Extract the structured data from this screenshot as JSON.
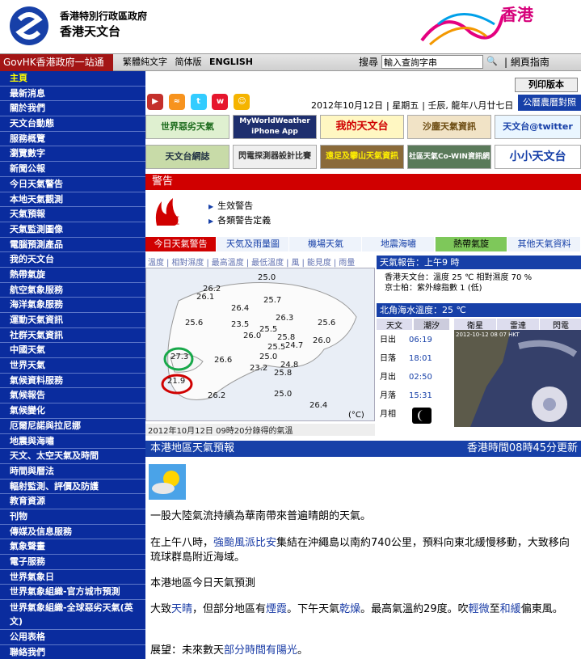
{
  "header": {
    "org_line1": "香港特別行政區政府",
    "org_line2": "香港天文台",
    "brand": "香港"
  },
  "topbar": {
    "govhk": "GovHK香港政府一站通",
    "lang_trad": "繁體純文字",
    "lang_simp": "简体版",
    "lang_en": "ENGLISH",
    "search_label": "搜尋",
    "search_placeholder": "輸入查詢字串",
    "sitemap": "網頁指南"
  },
  "sidebar": {
    "items": [
      "主頁",
      "最新消息",
      "關於我們",
      "天文台動態",
      "服務概覽",
      "瀏覽數字",
      "新聞公報",
      "今日天氣警告",
      "本地天氣觀測",
      "天氣預報",
      "天氣監測圖像",
      "電腦預測產品",
      "我的天文台",
      "熱帶氣旋",
      "航空氣象服務",
      "海洋氣象服務",
      "運動天氣資訊",
      "社群天氣資訊",
      "中國天氣",
      "世界天氣",
      "氣候資料服務",
      "氣候報告",
      "氣候變化",
      "厄爾尼諾與拉尼娜",
      "地震與海嘯",
      "天文、太空天氣及時間",
      "時間與曆法",
      "輻射監測、評價及防護",
      "教育資源",
      "刊物",
      "傳媒及信息服務",
      "氣象聲畫",
      "電子服務",
      "世界氣象日",
      "世界氣象組織-官方城市預測",
      "世界氣象組織-全球惡劣天氣(英文)",
      "公用表格",
      "聯絡我們"
    ]
  },
  "main": {
    "print": "列印版本",
    "date": "2012年10月12日",
    "weekday": "星期五",
    "lunar": "壬辰, 龍年八月廿七日",
    "lunar_btn": "公曆農曆對照",
    "banners": [
      "世界惡劣天氣",
      "MyWorldWeather iPhone App",
      "我的天文台",
      "沙塵天氣資訊",
      "天文台@twitter",
      "天文台網誌",
      "閃電探測器設計比賽",
      "遠足及攀山天氣資訊",
      "社區天氣Co-WIN資訊網絡",
      "小小天文台"
    ],
    "warning_title": "警告",
    "warning_level": "紅",
    "warning_links": [
      "生效警告",
      "各類警告定義"
    ],
    "tabs": [
      "今日天氣警告",
      "天気及雨量圖",
      "機場天氣",
      "地震海嘯",
      "熱帶氣旋",
      "其他天氣資料"
    ],
    "map_tabs": [
      "溫度",
      "相對濕度",
      "最高溫度",
      "最低溫度",
      "風",
      "能見度",
      "雨量"
    ],
    "temps": [
      "25.0",
      "26.2",
      "26.1",
      "25.7",
      "26.4",
      "26.3",
      "25.6",
      "23.5",
      "25.5",
      "25.6",
      "26.0",
      "25.8",
      "24.7",
      "25.5",
      "26.0",
      "26.6",
      "25.0",
      "24.8",
      "23.2",
      "25.8",
      "27.3",
      "21.9",
      "26.2",
      "25.0",
      "26.4"
    ],
    "map_unit": "(°C)",
    "map_caption": "2012年10月12日 09時20分錄得的氣溫",
    "report_title": "天氣報告：上午9 時",
    "report_line1": "香港天文台：溫度 25 ℃  相對濕度 70 %",
    "report_line2": "京士柏：紫外線指數 1 (低)",
    "sea_temp": "北角海水溫度：25 ℃",
    "astro_tabs": [
      "天文",
      "潮汐"
    ],
    "astro": [
      {
        "k": "日出",
        "v": "06:19"
      },
      {
        "k": "日落",
        "v": "18:01"
      },
      {
        "k": "月出",
        "v": "02:50"
      },
      {
        "k": "月落",
        "v": "15:31"
      },
      {
        "k": "月相",
        "v": ""
      }
    ],
    "sat_tabs": [
      "衛星",
      "雷達",
      "閃電"
    ],
    "sat_time": "2012-10-12 08 07 HKT",
    "local_title": "本港地區天氣預報",
    "local_time": "香港時間08時45分更新",
    "para1": "一股大陸氣流持續為華南帶來普遍晴朗的天氣。",
    "para2_a": "在上午八時，",
    "para2_hl": "強颱風派比安",
    "para2_b": "集結在沖繩島以南約740公里，預料向東北緩慢移動，大致移向琉球群島附近海域。",
    "para3": "本港地區今日天氣預測",
    "para4_a": "大致",
    "para4_hl1": "天晴",
    "para4_b": "，但部分地區有",
    "para4_hl2": "煙霞",
    "para4_c": "。下午天氣",
    "para4_hl3": "乾燥",
    "para4_d": "。最高氣溫約29度。吹",
    "para4_hl4": "輕微",
    "para4_e": "至",
    "para4_hl5": "和緩",
    "para4_f": "偏東風。",
    "para5_a": "展望：未來數天",
    "para5_hl": "部分時間有陽光",
    "para5_b": "。"
  },
  "colors": {
    "accent": "#1740a8",
    "warning": "#d00000",
    "sidebar": "#0a2c9e"
  }
}
